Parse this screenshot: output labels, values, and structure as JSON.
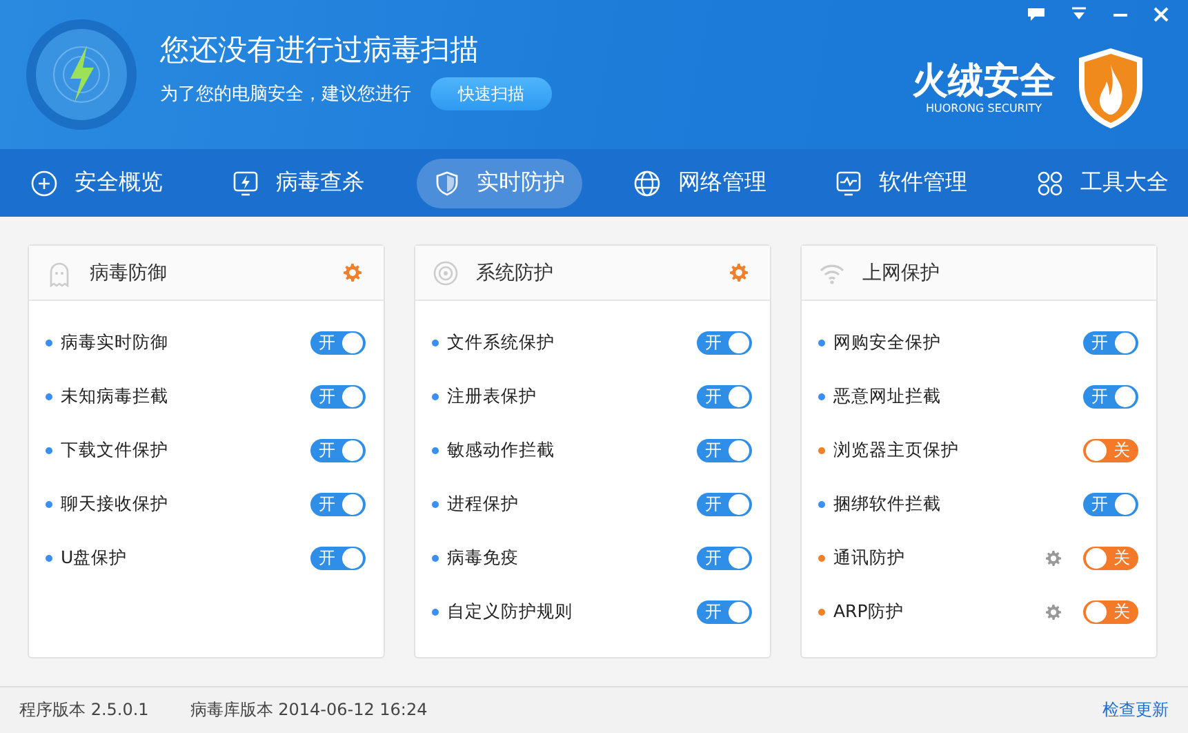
{
  "header": {
    "title": "您还没有进行过病毒扫描",
    "subtitle": "为了您的电脑安全，建议您进行",
    "scan_button": "快速扫描",
    "brand": "火绒安全",
    "brand_sub": "HUORONG SECURITY"
  },
  "tabs": [
    {
      "label": "安全概览",
      "selected": false
    },
    {
      "label": "病毒查杀",
      "selected": false
    },
    {
      "label": "实时防护",
      "selected": true
    },
    {
      "label": "网络管理",
      "selected": false
    },
    {
      "label": "软件管理",
      "selected": false
    },
    {
      "label": "工具大全",
      "selected": false
    }
  ],
  "cards": [
    {
      "title": "病毒防御",
      "settings": true,
      "items": [
        {
          "label": "病毒实时防御",
          "on": true,
          "switch_text": "开",
          "settings": false
        },
        {
          "label": "未知病毒拦截",
          "on": true,
          "switch_text": "开",
          "settings": false
        },
        {
          "label": "下载文件保护",
          "on": true,
          "switch_text": "开",
          "settings": false
        },
        {
          "label": "聊天接收保护",
          "on": true,
          "switch_text": "开",
          "settings": false
        },
        {
          "label": "U盘保护",
          "on": true,
          "switch_text": "开",
          "settings": false
        }
      ]
    },
    {
      "title": "系统防护",
      "settings": true,
      "items": [
        {
          "label": "文件系统保护",
          "on": true,
          "switch_text": "开",
          "settings": false
        },
        {
          "label": "注册表保护",
          "on": true,
          "switch_text": "开",
          "settings": false
        },
        {
          "label": "敏感动作拦截",
          "on": true,
          "switch_text": "开",
          "settings": false
        },
        {
          "label": "进程保护",
          "on": true,
          "switch_text": "开",
          "settings": false
        },
        {
          "label": "病毒免疫",
          "on": true,
          "switch_text": "开",
          "settings": false
        },
        {
          "label": "自定义防护规则",
          "on": true,
          "switch_text": "开",
          "settings": false
        }
      ]
    },
    {
      "title": "上网保护",
      "settings": false,
      "items": [
        {
          "label": "网购安全保护",
          "on": true,
          "switch_text": "开",
          "settings": false
        },
        {
          "label": "恶意网址拦截",
          "on": true,
          "switch_text": "开",
          "settings": false
        },
        {
          "label": "浏览器主页保护",
          "on": false,
          "switch_text": "关",
          "settings": false
        },
        {
          "label": "捆绑软件拦截",
          "on": true,
          "switch_text": "开",
          "settings": false
        },
        {
          "label": "通讯防护",
          "on": false,
          "switch_text": "关",
          "settings": true
        },
        {
          "label": "ARP防护",
          "on": false,
          "switch_text": "关",
          "settings": true
        }
      ]
    }
  ],
  "status_bar": {
    "program_version": "程序版本 2.5.0.1",
    "virus_db_version": "病毒库版本 2014-06-12 16:24",
    "update_link": "检查更新"
  }
}
